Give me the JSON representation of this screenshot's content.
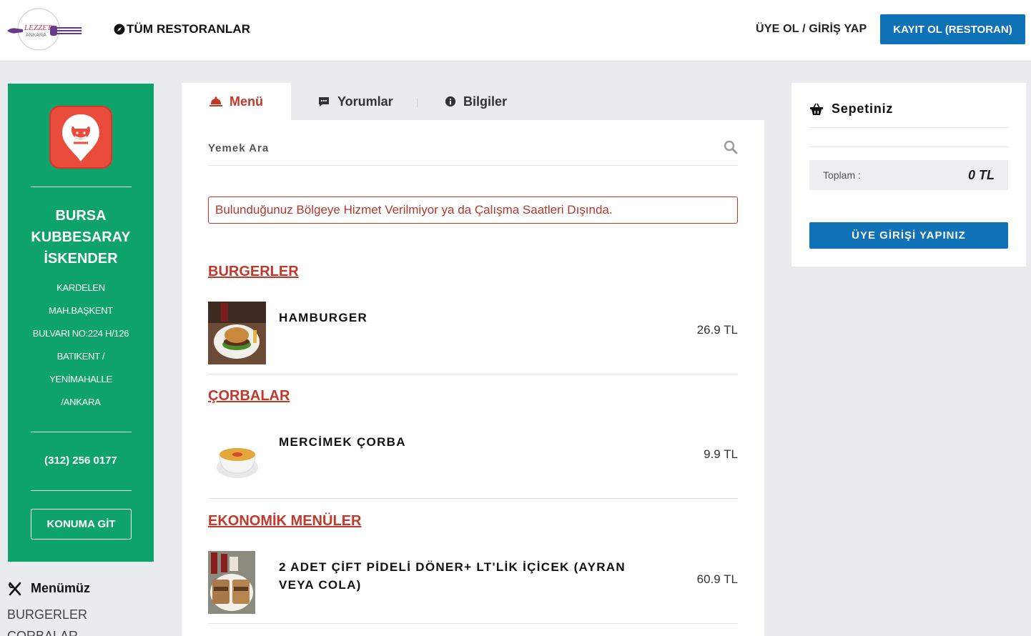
{
  "header": {
    "logo_text": "LEZZET",
    "logo_subtext": "ANKARA",
    "all_restaurants": "TÜM RESTORANLAR",
    "login_link": "ÜYE OL / GİRİŞ YAP",
    "register_button": "KAYIT OL (RESTORAN)"
  },
  "restaurant": {
    "name": "BURSA KUBBESARAY İSKENDER",
    "address_lines": [
      "KARDELEN",
      "MAH.BAŞKENT",
      "BULVARI NO:224 H/126",
      "BATIKENT /",
      "YENİMAHALLE",
      "/ANKARA"
    ],
    "phone": "(312) 256 0177",
    "location_button": "KONUMA GİT"
  },
  "sidebar": {
    "menu_title": "Menümüz",
    "links": [
      "BURGERLER",
      "ÇORBALAR"
    ]
  },
  "tabs": [
    {
      "label": "Menü",
      "icon": "cloche-icon",
      "active": true
    },
    {
      "label": "Yorumlar",
      "icon": "comment-icon",
      "active": false
    },
    {
      "label": "Bilgiler",
      "icon": "info-icon",
      "active": false
    }
  ],
  "search": {
    "placeholder": "Yemek Ara"
  },
  "alert": "Bulunduğunuz Bölgeye Hizmet Verilmiyor ya da Çalışma Saatleri Dışında.",
  "categories": [
    {
      "title": "BURGERLER",
      "items": [
        {
          "name": "HAMBURGER",
          "price": "26.9 TL"
        }
      ]
    },
    {
      "title": "ÇORBALAR",
      "items": [
        {
          "name": "MERCİMEK ÇORBA",
          "price": "9.9 TL"
        }
      ]
    },
    {
      "title": "EKONOMİK MENÜLER",
      "items": [
        {
          "name": "2 ADET ÇİFT PİDELİ DÖNER+ LT'LİK İÇİCEK (AYRAN VEYA COLA)",
          "price": "60.9 TL"
        }
      ]
    }
  ],
  "cart": {
    "title": "Sepetiniz",
    "total_label": "Toplam :",
    "total_value": "0 TL",
    "member_button": "ÜYE GİRİŞİ YAPINIZ"
  },
  "colors": {
    "brand_blue": "#0f72b7",
    "restaurant_green": "#0fa36c",
    "accent_red": "#c0392b"
  }
}
